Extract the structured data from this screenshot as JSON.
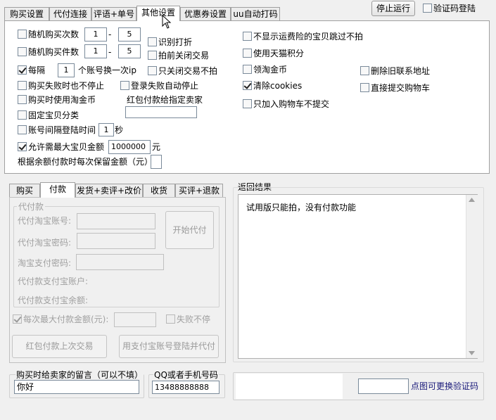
{
  "top_tabs": [
    "购买设置",
    "代付连接",
    "评语+单号",
    "其他设置",
    "优惠券设置",
    "uu自动打码"
  ],
  "stop_button": "停止运行",
  "verify_login": {
    "label": "验证码登陆",
    "checked": false
  },
  "other": {
    "random_buy_count": {
      "label": "随机购买次数",
      "min": "1",
      "max": "5",
      "dash": "-"
    },
    "random_buy_pieces": {
      "label": "随机购买件数",
      "min": "1",
      "max": "5",
      "dash": "-"
    },
    "every": {
      "label": "每隔",
      "value": "1",
      "suffix": "个账号换一次ip"
    },
    "no_stop_on_fail": "购买失败时也不停止",
    "login_fail_stop": "登录失败自动停止",
    "use_taobao_coin": "购买时使用淘金币",
    "redpack_label": "红包付款给指定卖家",
    "redpack_value": "",
    "fixed_category": "固定宝贝分类",
    "login_interval": {
      "label": "账号间隔登陆时间",
      "value": "1",
      "suffix": "秒"
    },
    "max_amount": {
      "label": "允许需最大宝贝金额",
      "value": "1000000",
      "suffix": "元"
    },
    "reserve_label": "根据余额付款时每次保留金额（元）",
    "reserve_value": "",
    "identify_discount": "识别打折",
    "close_before": "拍前关闭交易",
    "only_close": "只关闭交易不拍",
    "no_freight": "不显示运费险的宝贝跳过不拍",
    "tmall_points": "使用天猫积分",
    "claim_coin": "领淘金币",
    "clear_cookies": "清除cookies",
    "only_cart": "只加入购物车不提交",
    "delete_old_contact": "删除旧联系地址",
    "direct_cart": "直接提交购物车"
  },
  "sub_tabs": [
    "购买",
    "付款",
    "发货+卖评+改价",
    "收货",
    "买评+退款"
  ],
  "pay": {
    "group_title": "代付款",
    "account_label": "代付淘宝账号:",
    "password_label": "代付淘宝密码:",
    "pay_password_label": "淘宝支付密码:",
    "alipay_account_label": "代付款支付宝账户:",
    "alipay_balance_label": "代付款支付宝余额:",
    "start_button": "开始代付",
    "max_pay_label": "每次最大付款金额(元):",
    "fail_continue": "失败不停",
    "redpack_last": "红包付款上次交易",
    "alipay_login_pay": "用支付宝账号登陆并代付"
  },
  "result": {
    "title": "返回结果",
    "text": "试用版只能拍，没有付款功能"
  },
  "message": {
    "label": "购买时给卖家的留言（可以不填）",
    "value": "你好"
  },
  "qq": {
    "label": "QQ或者手机号码",
    "value": "13488888888"
  },
  "captcha": {
    "link": "点图可更换验证码",
    "value": ""
  }
}
